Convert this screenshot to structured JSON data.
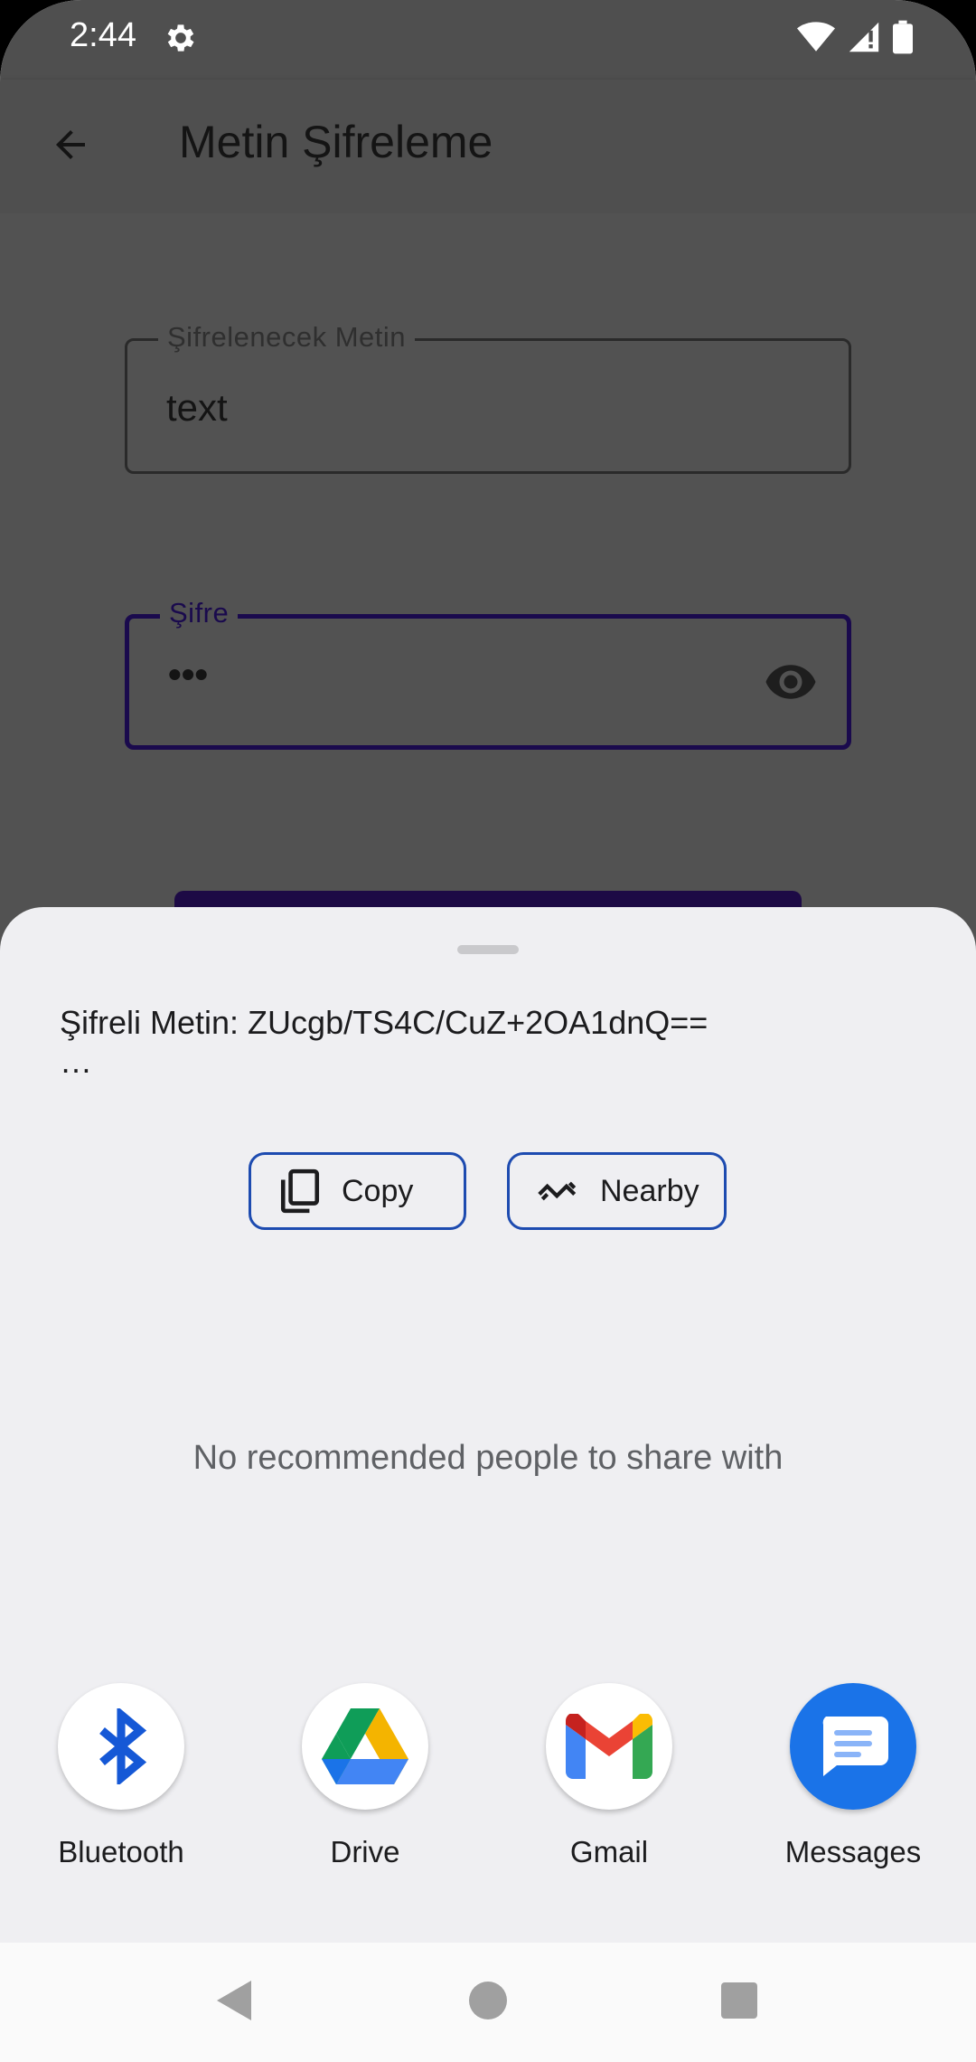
{
  "status_bar": {
    "time": "2:44",
    "icons": [
      "gear-icon",
      "wifi-icon",
      "signal-icon",
      "battery-icon"
    ]
  },
  "app_bar": {
    "title": "Metin Şifreleme",
    "back_icon": "arrow-back-icon"
  },
  "form": {
    "text_field": {
      "label": "Şifrelenecek Metin",
      "value": "text"
    },
    "password_field": {
      "label": "Şifre",
      "value": "•••",
      "toggle_icon": "eye-icon"
    }
  },
  "share_sheet": {
    "shared_text": "Şifreli Metin: ZUcgb/TS4C/CuZ+2OA1dnQ==",
    "ellipsis": "…",
    "actions": [
      {
        "label": "Copy",
        "icon": "copy-icon"
      },
      {
        "label": "Nearby",
        "icon": "nearby-icon"
      }
    ],
    "empty_message": "No recommended people to share with",
    "apps": [
      {
        "label": "Bluetooth",
        "icon": "bluetooth-icon"
      },
      {
        "label": "Drive",
        "icon": "drive-icon"
      },
      {
        "label": "Gmail",
        "icon": "gmail-icon"
      },
      {
        "label": "Messages",
        "icon": "messages-icon"
      }
    ]
  },
  "colors": {
    "accent": "#1d4bb0",
    "scrim_background": "#525252",
    "sheet_background": "#efeff2",
    "focused_field": "#1a0a4d"
  }
}
